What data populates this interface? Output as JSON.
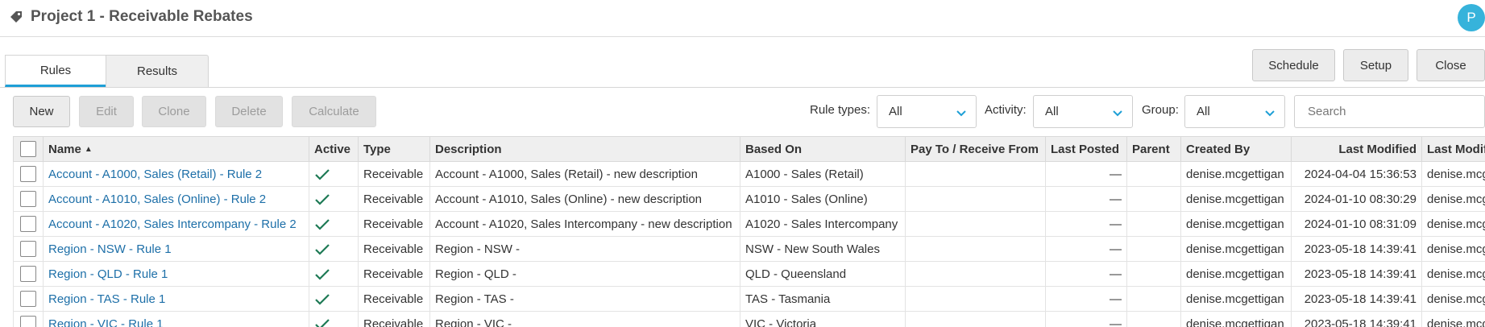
{
  "header": {
    "title": "Project 1 - Receivable Rebates",
    "avatar_initial": "P"
  },
  "tabs": [
    {
      "label": "Rules",
      "active": true
    },
    {
      "label": "Results",
      "active": false
    }
  ],
  "top_actions": {
    "schedule": "Schedule",
    "setup": "Setup",
    "close": "Close"
  },
  "toolbar": {
    "new": "New",
    "edit": "Edit",
    "clone": "Clone",
    "delete": "Delete",
    "calculate": "Calculate",
    "disabled": [
      "Edit",
      "Clone",
      "Delete",
      "Calculate"
    ]
  },
  "filters": {
    "rule_types": {
      "label": "Rule types:",
      "value": "All"
    },
    "activity": {
      "label": "Activity:",
      "value": "All"
    },
    "group": {
      "label": "Group:",
      "value": "All"
    },
    "search_placeholder": "Search"
  },
  "colors": {
    "accent": "#1e9fd6",
    "link": "#1d6fa8",
    "check": "#1e7a55",
    "avatar": "#36b3db"
  },
  "table": {
    "columns": [
      "",
      "Name",
      "Active",
      "Type",
      "Description",
      "Based On",
      "Pay To / Receive From",
      "Last Posted",
      "Parent",
      "Created By",
      "Last Modified",
      "Last Modified By"
    ],
    "column_headers": {
      "name": "Name",
      "active": "Active",
      "type": "Type",
      "description": "Description",
      "based_on": "Based On",
      "pay_to": "Pay To / Receive From",
      "last_posted": "Last Posted",
      "parent": "Parent",
      "created_by": "Created By",
      "last_modified": "Last Modified",
      "last_modified_by": "Last Modifie"
    },
    "sorted_by": "Name ascending",
    "rows": [
      {
        "name": "Account - A1000, Sales (Retail) - Rule 2",
        "active": true,
        "type": "Receivable",
        "description": "Account - A1000, Sales (Retail) - new description",
        "based_on": "A1000 - Sales (Retail)",
        "pay_to": "",
        "last_posted": "—",
        "parent": "",
        "created_by": "denise.mcgettigan",
        "last_modified": "2024-04-04 15:36:53",
        "last_modified_by": "denise.mcge"
      },
      {
        "name": "Account - A1010, Sales (Online) - Rule 2",
        "active": true,
        "type": "Receivable",
        "description": "Account - A1010, Sales (Online) - new description",
        "based_on": "A1010 - Sales (Online)",
        "pay_to": "",
        "last_posted": "—",
        "parent": "",
        "created_by": "denise.mcgettigan",
        "last_modified": "2024-01-10 08:30:29",
        "last_modified_by": "denise.mcge"
      },
      {
        "name": "Account - A1020, Sales Intercompany - Rule 2",
        "active": true,
        "type": "Receivable",
        "description": "Account - A1020, Sales Intercompany - new description",
        "based_on": "A1020 - Sales Intercompany",
        "pay_to": "",
        "last_posted": "—",
        "parent": "",
        "created_by": "denise.mcgettigan",
        "last_modified": "2024-01-10 08:31:09",
        "last_modified_by": "denise.mcge"
      },
      {
        "name": "Region - NSW - Rule 1",
        "active": true,
        "type": "Receivable",
        "description": "Region - NSW -",
        "based_on": "NSW - New South Wales",
        "pay_to": "",
        "last_posted": "—",
        "parent": "",
        "created_by": "denise.mcgettigan",
        "last_modified": "2023-05-18 14:39:41",
        "last_modified_by": "denise.mcge"
      },
      {
        "name": "Region - QLD - Rule 1",
        "active": true,
        "type": "Receivable",
        "description": "Region - QLD -",
        "based_on": "QLD - Queensland",
        "pay_to": "",
        "last_posted": "—",
        "parent": "",
        "created_by": "denise.mcgettigan",
        "last_modified": "2023-05-18 14:39:41",
        "last_modified_by": "denise.mcge"
      },
      {
        "name": "Region - TAS - Rule 1",
        "active": true,
        "type": "Receivable",
        "description": "Region - TAS -",
        "based_on": "TAS - Tasmania",
        "pay_to": "",
        "last_posted": "—",
        "parent": "",
        "created_by": "denise.mcgettigan",
        "last_modified": "2023-05-18 14:39:41",
        "last_modified_by": "denise.mcge"
      },
      {
        "name": "Region - VIC - Rule 1",
        "active": true,
        "type": "Receivable",
        "description": "Region - VIC -",
        "based_on": "VIC - Victoria",
        "pay_to": "",
        "last_posted": "—",
        "parent": "",
        "created_by": "denise.mcgettigan",
        "last_modified": "2023-05-18 14:39:41",
        "last_modified_by": "denise.mcge"
      }
    ]
  }
}
